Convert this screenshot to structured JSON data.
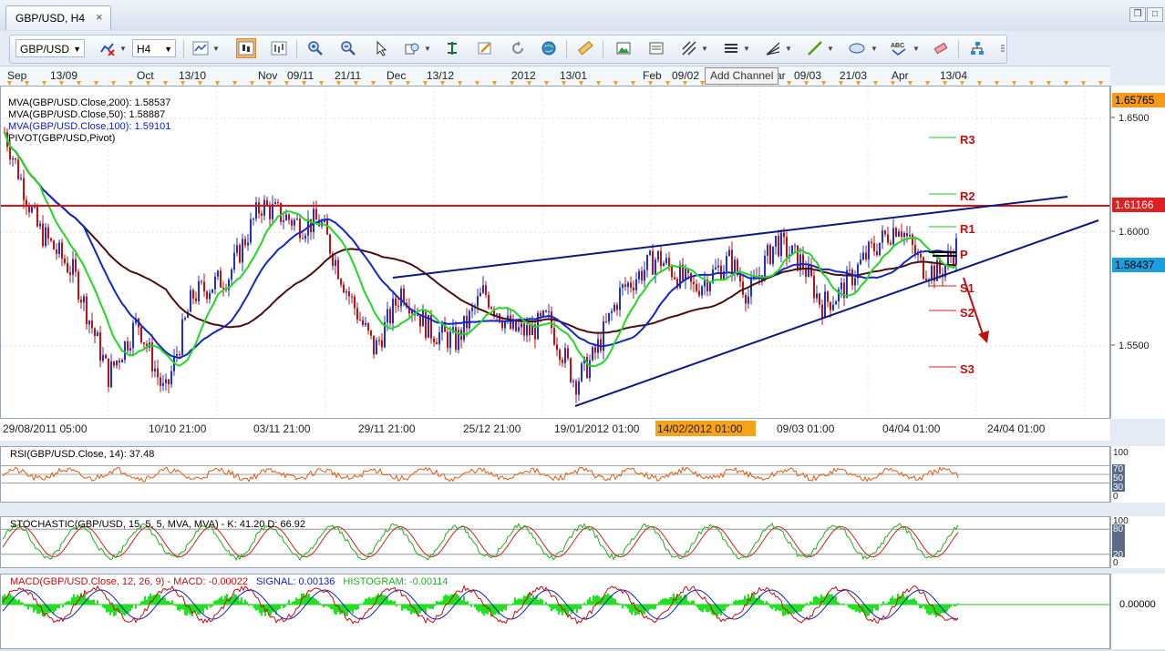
{
  "tab": {
    "title": "GBP/USD, H4",
    "close": "×"
  },
  "toolbar": {
    "symbol": "GBP/USD",
    "timeframe": "H4",
    "tooltip": "Add Channel",
    "buttons": [
      "line-chart-icon",
      "candle-chart-icon",
      "bar-chart-icon",
      "zoom-in-icon",
      "zoom-out-icon",
      "cursor-icon",
      "indicator-icon",
      "crosshair-icon",
      "drawing-icon",
      "period-icon",
      "globe-icon",
      "ruler-icon",
      "picture-icon",
      "template-icon",
      "pitchfork-icon",
      "horizontal-lines-icon",
      "fan-icon",
      "trendline-icon",
      "ellipse-icon",
      "text-icon",
      "tree-icon",
      "more-icon"
    ]
  },
  "top_dates": [
    "Sep",
    "13/09",
    "Oct",
    "13/10",
    "Nov",
    "09/11",
    "21/11",
    "Dec",
    "13/12",
    "2012",
    "13/01",
    "Feb",
    "09/02",
    "Mar",
    "09/03",
    "21/03",
    "Apr",
    "13/04"
  ],
  "main_chart": {
    "legend": [
      {
        "text": "MVA(GBP/USD.Close,200): 1.58537",
        "color": "#000000"
      },
      {
        "text": "MVA(GBP/USD.Close,50): 1.58887",
        "color": "#000000"
      },
      {
        "text": "MVA(GBP/USD.Close,100): 1.59101",
        "color": "#1020c0"
      },
      {
        "text": "PIVOT(GBP/USD,Pivot)",
        "color": "#000000"
      }
    ],
    "price_ticks": [
      "1.6500",
      "1.6000",
      "1.5500"
    ],
    "price_tags": [
      {
        "text": "1.65765",
        "bg": "#f59a1a",
        "fg": "#000000"
      },
      {
        "text": "1.61166",
        "bg": "#e02020",
        "fg": "#ffffff"
      },
      {
        "text": "1.58437",
        "bg": "#1aa0e0",
        "fg": "#000000"
      }
    ],
    "pivot_labels": [
      "R3",
      "R2",
      "R1",
      "P",
      "S1",
      "S2",
      "S3"
    ],
    "x_labels": [
      "29/08/2011 05:00",
      "10/10 21:00",
      "03/11 21:00",
      "29/11 21:00",
      "25/12 21:00",
      "19/01/2012 01:00",
      "14/02/2012 01:00",
      "09/03 01:00",
      "04/04 01:00",
      "24/04 01:00"
    ],
    "highlighted_x_label": "14/02/2012 01:00"
  },
  "rsi": {
    "label": "RSI(GBP/USD.Close, 14): 37.48",
    "color": "#e05a10",
    "ticks": [
      "100",
      "70",
      "50",
      "30",
      "0"
    ]
  },
  "stochastic": {
    "label": "STOCHASTIC(GBP/USD, 15, 5, 5, MVA, MVA) - K: 41.20   D: 66.92",
    "color": "#20c020",
    "ticks": [
      "100",
      "80",
      "20",
      "0"
    ]
  },
  "macd": {
    "label": "MACD(GBP/USD.Close, 12, 26, 9) - MACD: -0.00022",
    "signal": "SIGNAL: 0.00136",
    "histogram": "HISTOGRAM: -0.00114",
    "tick": "0.00000"
  },
  "colors": {
    "up": "#2030d0",
    "down": "#c01010",
    "ma50": "#22d822",
    "ma100": "#1028c8",
    "ma200": "#4a1010",
    "channel": "#0a1a80",
    "resistance": "#e01010"
  }
}
